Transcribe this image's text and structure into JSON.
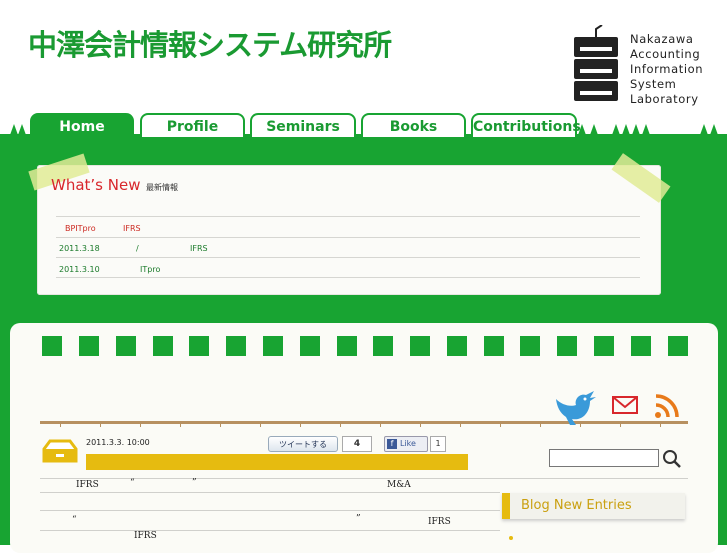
{
  "header": {
    "site_title": "中澤会計情報システム研究所",
    "logo_lines": [
      "Nakazawa",
      "Accounting",
      "Information",
      "System",
      "Laboratory"
    ]
  },
  "nav": {
    "tabs": [
      {
        "label": "Home",
        "active": true
      },
      {
        "label": "Profile",
        "active": false
      },
      {
        "label": "Seminars",
        "active": false
      },
      {
        "label": "Books",
        "active": false
      },
      {
        "label": "Contributions",
        "active": false
      }
    ]
  },
  "news": {
    "title": "What’s New",
    "subtitle": "最新情報",
    "items": [
      {
        "date": "",
        "parts": [
          "BPITpro",
          "IFRS"
        ]
      },
      {
        "date": "2011.3.18",
        "parts": [
          "/",
          "IFRS"
        ]
      },
      {
        "date": "2011.3.10",
        "parts": [
          "ITpro"
        ]
      }
    ]
  },
  "post": {
    "date": "2011.3.3. 10:00",
    "tweet_label": "ツイートする",
    "tweet_count": "4",
    "like_label": "Like",
    "like_count": "1",
    "lines": [
      [
        "IFRS",
        "“",
        "”",
        "M&A"
      ],
      [
        "“",
        "”",
        "IFRS"
      ],
      [
        "IFRS"
      ]
    ]
  },
  "search": {
    "value": "",
    "placeholder": ""
  },
  "sidebar": {
    "blog_title": "Blog New Entries"
  },
  "colors": {
    "brand_green": "#18a432",
    "accent_yellow": "#e6bb10",
    "news_red": "#d8272c"
  },
  "icons": [
    "twitter-icon",
    "mail-icon",
    "rss-icon",
    "search-icon",
    "post-icon"
  ]
}
